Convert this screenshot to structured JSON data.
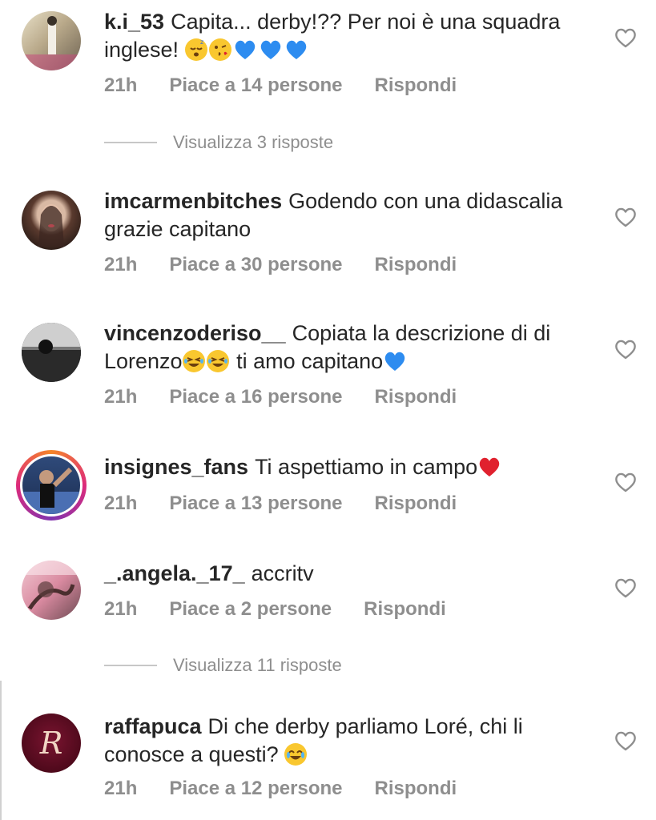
{
  "comments": [
    {
      "username": "k.i_53",
      "text": "Capita... derby!?? Per noi è una squadra inglese!",
      "time": "21h",
      "likes": "Piace a 14 persone",
      "reply": "Rispondi",
      "emojis": [
        "sleeping-face",
        "kissing-face",
        "blue-heart",
        "blue-heart",
        "blue-heart"
      ]
    },
    {
      "username": "imcarmenbitches",
      "text": "Godendo con una didascalia grazie capitano",
      "time": "21h",
      "likes": "Piace a 30 persone",
      "reply": "Rispondi"
    },
    {
      "username": "vincenzoderiso__",
      "text_a": "Copiata la descrizione di di Lorenzo",
      "text_b": " ti amo capitano",
      "time": "21h",
      "likes": "Piace a 16 persone",
      "reply": "Rispondi",
      "emojis": [
        "rofl-face",
        "rofl-face",
        "blue-heart"
      ]
    },
    {
      "username": "insignes_fans",
      "text": "Ti aspettiamo in campo",
      "time": "21h",
      "likes": "Piace a 13 persone",
      "reply": "Rispondi",
      "emojis": [
        "red-heart"
      ]
    },
    {
      "username": "_.angela._17_",
      "text": "accritv",
      "time": "21h",
      "likes": "Piace a 2 persone",
      "reply": "Rispondi"
    },
    {
      "username": "raffapuca",
      "text": "Di che derby parliamo Loré, chi li conosce a questi?",
      "time": "21h",
      "likes": "Piace a 12 persone",
      "reply": "Rispondi",
      "emojis": [
        "joy-face"
      ],
      "avatar_letter": "R"
    }
  ],
  "view_replies": [
    "Visualizza 3 risposte",
    "Visualizza 11 risposte"
  ],
  "icons": {
    "like": "heart-outline-icon"
  },
  "colors": {
    "text": "#262626",
    "muted": "#8e8e8e",
    "blue_heart": "#2d8cf0",
    "red_heart": "#e0212e",
    "emoji_yellow": "#f9c72f",
    "story_ring_from": "#f58529",
    "story_ring_to": "#8134af",
    "raffapuca_avatar": "#5b0b1f"
  }
}
